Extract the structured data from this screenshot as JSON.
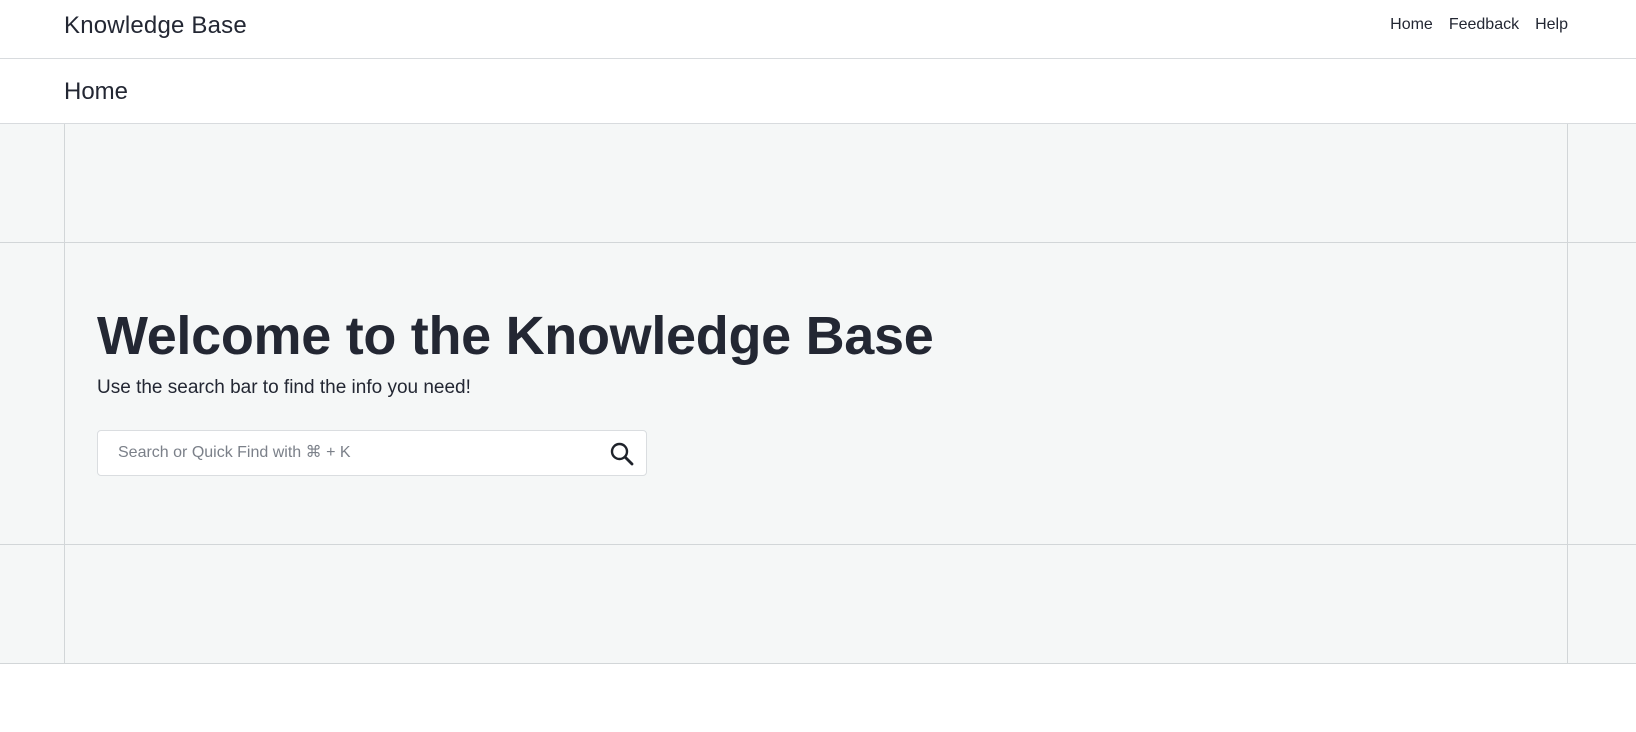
{
  "header": {
    "brand": "Knowledge Base",
    "nav": [
      {
        "label": "Home"
      },
      {
        "label": "Feedback"
      },
      {
        "label": "Help"
      }
    ]
  },
  "breadcrumb": {
    "title": "Home"
  },
  "hero": {
    "heading": "Welcome to the Knowledge Base",
    "subheading": "Use the search bar to find the info you need!",
    "search": {
      "placeholder": "Search or Quick Find with ⌘ + K",
      "value": "",
      "icon": "search-icon"
    }
  },
  "colors": {
    "text": "#232733",
    "hero_background": "#f5f7f7",
    "grid_lines": "#d2d6d8",
    "placeholder": "#7b8089"
  }
}
